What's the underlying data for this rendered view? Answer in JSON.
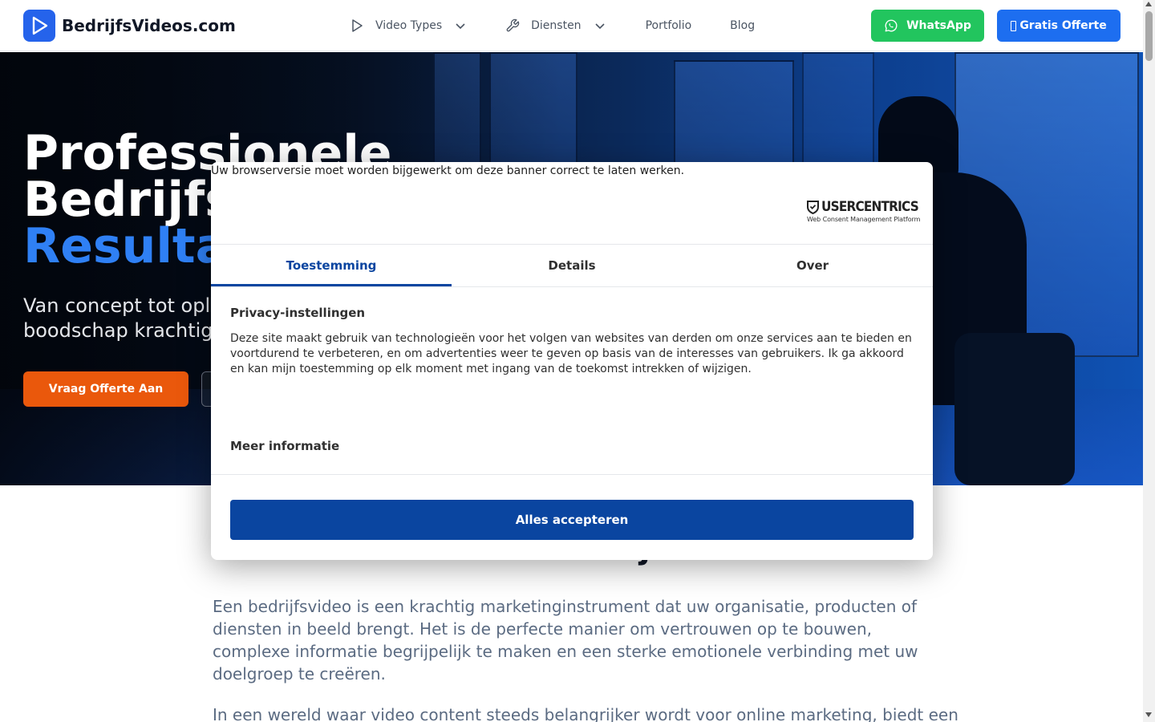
{
  "header": {
    "logo_text": "BedrijfsVideos.com",
    "nav": {
      "video_types": "Video Types",
      "diensten": "Diensten",
      "portfolio": "Portfolio",
      "blog": "Blog"
    },
    "whatsapp_label": "WhatsApp",
    "offerte_label": "Gratis Offerte"
  },
  "hero": {
    "title_line1": "Professionele",
    "title_line2": "Bedrijfs",
    "title_line3": "Resulta",
    "subtitle_line1": "Van concept tot opl",
    "subtitle_line2": "boodschap krachtig",
    "cta_primary": "Vraag Offerte Aan"
  },
  "content": {
    "heading": "Wat is een Bedrijfsvideo?",
    "paragraph1": "Een bedrijfsvideo is een krachtig marketinginstrument dat uw organisatie, producten of diensten in beeld brengt. Het is de perfecte manier om vertrouwen op te bouwen, complexe informatie begrijpelijk te maken en een sterke emotionele verbinding met uw doelgroep te creëren.",
    "paragraph2": "In een wereld waar video content steeds belangrijker wordt voor online marketing, biedt een"
  },
  "consent": {
    "browser_warning": "Uw browserversie moet worden bijgewerkt om deze banner correct te laten werken.",
    "logo_name": "USERCENTRICS",
    "logo_tagline": "Web Consent Management Platform",
    "tabs": [
      "Toestemming",
      "Details",
      "Over"
    ],
    "section_title": "Privacy-instellingen",
    "section_text": "Deze site maakt gebruik van technologieën voor het volgen van websites van derden om onze services aan te bieden en voortdurend te verbeteren, en om advertenties weer te geven op basis van de interesses van gebruikers. Ik ga akkoord en kan mijn toestemming op elk moment met ingang van de toekomst intrekken of wijzigen.",
    "more_info": "Meer informatie",
    "accept_label": "Alles accepteren"
  },
  "colors": {
    "brand_blue": "#2563eb",
    "whatsapp_green": "#22c55e",
    "cta_orange": "#ea580c",
    "consent_blue": "#0a45a0"
  },
  "icons": {
    "logo": "play-icon",
    "video_types": "play-outline-icon",
    "diensten": "wrench-icon",
    "whatsapp": "whatsapp-icon",
    "dropdown": "chevron-down-icon"
  }
}
